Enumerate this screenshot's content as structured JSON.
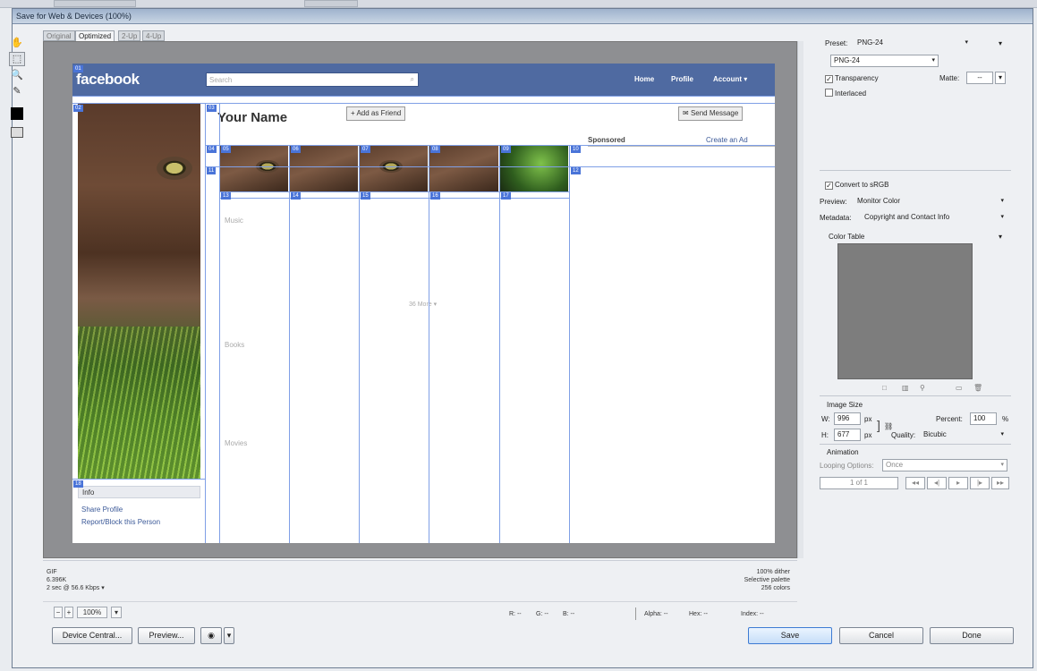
{
  "window": {
    "title": "Save for Web & Devices (100%)"
  },
  "tabs": [
    {
      "label": "Original"
    },
    {
      "label": "Optimized"
    },
    {
      "label": "2-Up"
    },
    {
      "label": "4-Up"
    }
  ],
  "facebook": {
    "logo": "facebook",
    "search_placeholder": "Search",
    "nav": {
      "home": "Home",
      "profile": "Profile",
      "account": "Account ▾"
    },
    "name": "Your Name",
    "add_friend": "Add as Friend",
    "send_message": "Send Message",
    "sponsored": "Sponsored",
    "create_ad": "Create an Ad",
    "sections": {
      "music": "Music",
      "books": "Books",
      "movies": "Movies"
    },
    "more": "36 More ▾",
    "info_tab": "Info",
    "share_profile": "Share Profile",
    "report_block": "Report/Block this Person"
  },
  "slice_labels": [
    "01",
    "02",
    "03",
    "04",
    "05",
    "06",
    "07",
    "08",
    "09",
    "10",
    "11",
    "12",
    "13",
    "14",
    "15",
    "16",
    "17",
    "18"
  ],
  "optimize": {
    "preset_label": "Preset:",
    "preset_value": "PNG-24",
    "format_value": "PNG-24",
    "transparency": "Transparency",
    "matte_label": "Matte:",
    "matte_value": "--",
    "interlaced": "Interlaced",
    "convert_srgb": "Convert to sRGB",
    "preview_label": "Preview:",
    "preview_value": "Monitor Color",
    "metadata_label": "Metadata:",
    "metadata_value": "Copyright and Contact Info",
    "color_table": "Color Table",
    "image_size": "Image Size",
    "w_label": "W:",
    "w_value": "996",
    "h_label": "H:",
    "h_value": "677",
    "px": "px",
    "percent_label": "Percent:",
    "percent_value": "100",
    "percent_unit": "%",
    "quality_label": "Quality:",
    "quality_value": "Bicubic",
    "animation": "Animation",
    "looping_label": "Looping Options:",
    "looping_value": "Once",
    "frame_counter": "1 of 1"
  },
  "info_left": {
    "format": "GIF",
    "size": "6.396K",
    "time": "2 sec @ 56.6 Kbps"
  },
  "info_right": {
    "dither": "100% dither",
    "palette": "Selective palette",
    "colors": "256 colors"
  },
  "zoom": {
    "value": "100%"
  },
  "readouts": {
    "r": "R: --",
    "g": "G: --",
    "b": "B: --",
    "alpha": "Alpha: --",
    "hex": "Hex: --",
    "index": "Index: --"
  },
  "buttons": {
    "device_central": "Device Central...",
    "preview": "Preview...",
    "save": "Save",
    "cancel": "Cancel",
    "done": "Done"
  },
  "icons": {
    "hand": "✋",
    "slice_select": "⬚",
    "zoom": "🔍",
    "eyedropper": "✎",
    "menu": "▾",
    "link": "⛓"
  }
}
